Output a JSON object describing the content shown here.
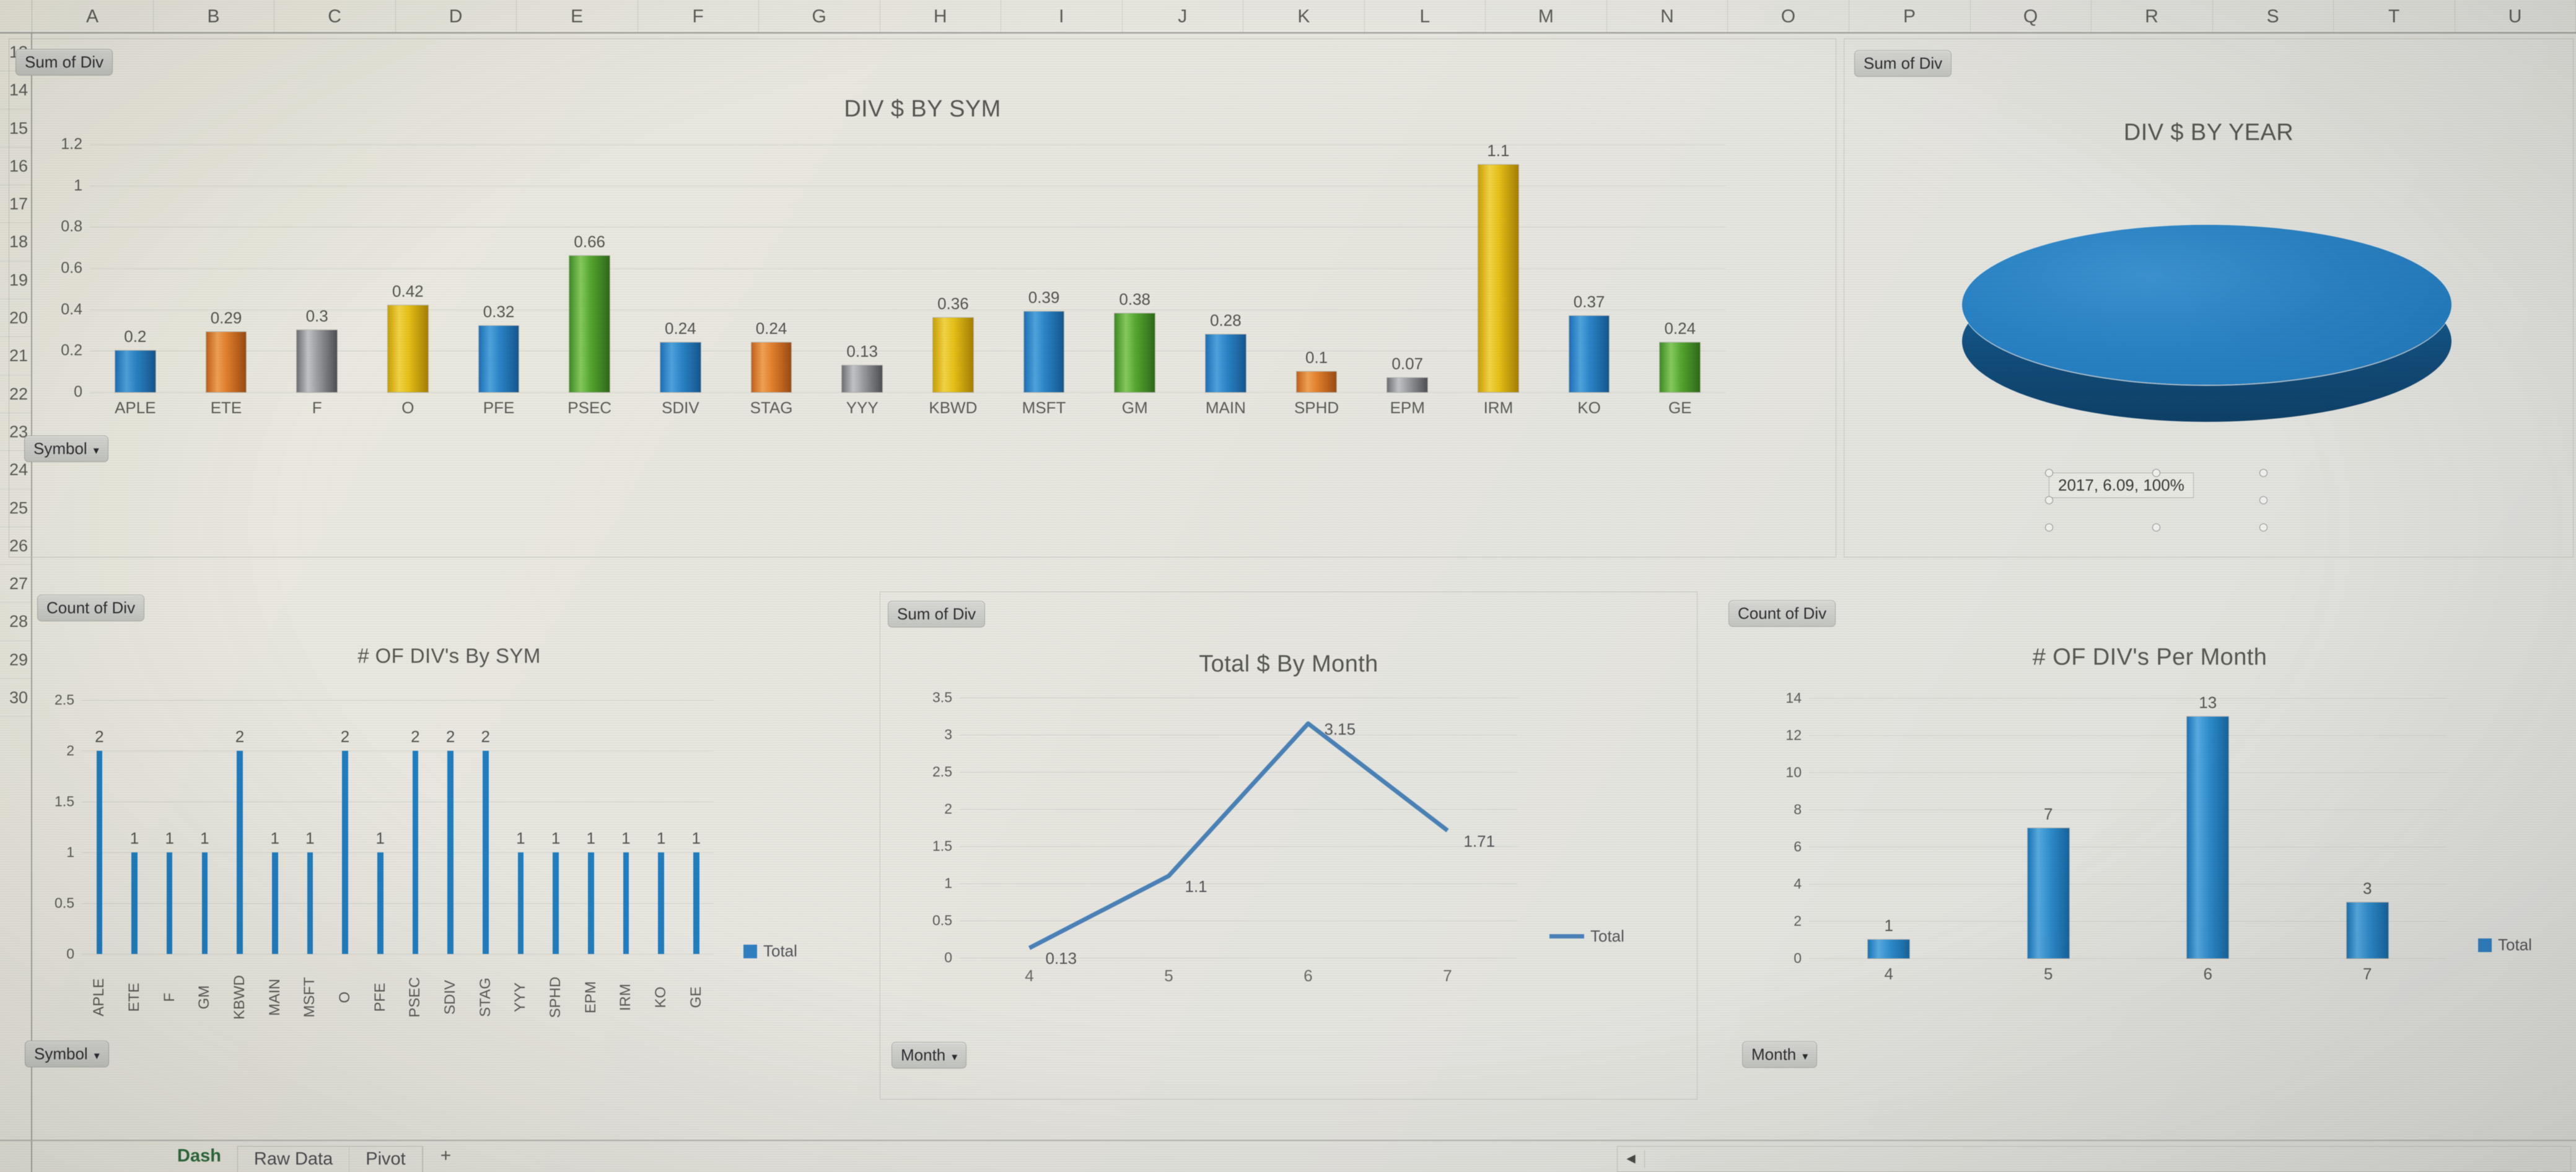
{
  "spreadsheet": {
    "column_headers": [
      "A",
      "B",
      "C",
      "D",
      "E",
      "F",
      "G",
      "H",
      "I",
      "J",
      "K",
      "L",
      "M",
      "N",
      "O",
      "P",
      "Q",
      "R",
      "S",
      "T",
      "U"
    ],
    "row_headers": [
      "13",
      "14",
      "15",
      "16",
      "17",
      "18",
      "19",
      "20",
      "21",
      "22",
      "23",
      "24",
      "25",
      "26",
      "27",
      "28",
      "29",
      "30"
    ],
    "sheet_tabs": [
      {
        "label": "Dash",
        "active": true
      },
      {
        "label": "Raw Data",
        "active": false
      },
      {
        "label": "Pivot",
        "active": false
      }
    ],
    "add_sheet_label": "+",
    "scroll_left_arrow": "◄"
  },
  "charts": {
    "div_by_sym": {
      "field_button": "Sum of Div",
      "slicer_button": "Symbol",
      "slicer_caret": "▾"
    },
    "div_by_year": {
      "field_button": "Sum of Div"
    },
    "div_count_by_sym": {
      "field_button": "Count of Div",
      "slicer_button": "Symbol",
      "slicer_caret": "▾"
    },
    "total_by_month": {
      "field_button": "Sum of Div",
      "slicer_button": "Month",
      "slicer_caret": "▾"
    },
    "count_per_month": {
      "field_button": "Count of Div",
      "slicer_button": "Month",
      "slicer_caret": "▾"
    }
  },
  "chart_data": [
    {
      "id": "div_by_sym",
      "type": "bar",
      "title": "DIV $ BY SYM",
      "xlabel": "",
      "ylabel": "",
      "ylim": [
        0,
        1.2
      ],
      "yticks": [
        "0",
        "0.2",
        "0.4",
        "0.6",
        "0.8",
        "1",
        "1.2"
      ],
      "grid": true,
      "legend": null,
      "categories": [
        "APLE",
        "ETE",
        "F",
        "O",
        "PFE",
        "PSEC",
        "SDIV",
        "STAG",
        "YYY",
        "KBWD",
        "MSFT",
        "GM",
        "MAIN",
        "SPHD",
        "EPM",
        "IRM",
        "KO",
        "GE"
      ],
      "values": [
        0.2,
        0.29,
        0.3,
        0.42,
        0.32,
        0.66,
        0.24,
        0.24,
        0.13,
        0.36,
        0.39,
        0.38,
        0.28,
        0.1,
        0.07,
        1.1,
        0.37,
        0.24
      ],
      "data_labels": [
        "0.2",
        "0.29",
        "0.3",
        "0.42",
        "0.32",
        "0.66",
        "0.24",
        "0.24",
        "0.13",
        "0.36",
        "0.39",
        "0.38",
        "0.28",
        "0.1",
        "0.07",
        "1.1",
        "0.37",
        "0.24"
      ],
      "colors": [
        "#2b85c8",
        "#e2802c",
        "#9a9ca0",
        "#e5c017",
        "#2b85c8",
        "#56a832",
        "#2b85c8",
        "#e2802c",
        "#9a9ca0",
        "#e5c017",
        "#2b85c8",
        "#56a832",
        "#2b85c8",
        "#e2802c",
        "#9a9ca0",
        "#e5c017",
        "#2b85c8",
        "#56a832"
      ],
      "fill_classes": [
        "fill-blue",
        "fill-orange",
        "fill-gray",
        "fill-yellow",
        "fill-blue",
        "fill-green",
        "fill-blue",
        "fill-orange",
        "fill-gray",
        "fill-yellow",
        "fill-blue",
        "fill-green",
        "fill-blue",
        "fill-orange",
        "fill-gray",
        "fill-yellow",
        "fill-blue",
        "fill-green"
      ]
    },
    {
      "id": "div_by_year",
      "type": "pie",
      "title": "DIV $ BY YEAR",
      "labels": [
        "2017"
      ],
      "values": [
        6.09
      ],
      "percentages": [
        "100%"
      ],
      "data_label": "2017, 6.09, 100%",
      "colors": [
        "#2b85c8"
      ],
      "style": "3-D pie",
      "legend": null
    },
    {
      "id": "div_count_by_sym",
      "type": "bar",
      "title": "# OF DIV's By SYM",
      "xlabel": "",
      "ylabel": "",
      "ylim": [
        0,
        2.5
      ],
      "yticks": [
        "0",
        "0.5",
        "1",
        "1.5",
        "2",
        "2.5"
      ],
      "grid": true,
      "legend": "Total",
      "legend_position": "right",
      "categories": [
        "APLE",
        "ETE",
        "F",
        "GM",
        "KBWD",
        "MAIN",
        "MSFT",
        "O",
        "PFE",
        "PSEC",
        "SDIV",
        "STAG",
        "YYY",
        "SPHD",
        "EPM",
        "IRM",
        "KO",
        "GE"
      ],
      "values": [
        2,
        1,
        1,
        1,
        2,
        1,
        1,
        2,
        1,
        2,
        2,
        2,
        1,
        1,
        1,
        1,
        1,
        1
      ],
      "data_labels": [
        "2",
        "1",
        "1",
        "1",
        "2",
        "1",
        "1",
        "2",
        "1",
        "2",
        "2",
        "2",
        "1",
        "1",
        "1",
        "1",
        "1",
        "1"
      ],
      "colors": [
        "#1f7ec0"
      ]
    },
    {
      "id": "total_by_month",
      "type": "line",
      "title": "Total $ By Month",
      "xlabel": "",
      "ylabel": "",
      "ylim": [
        0,
        3.5
      ],
      "yticks": [
        "0",
        "0.5",
        "1",
        "1.5",
        "2",
        "2.5",
        "3",
        "3.5"
      ],
      "grid": true,
      "legend": "Total",
      "legend_position": "right",
      "x": [
        "4",
        "5",
        "6",
        "7"
      ],
      "values": [
        0.13,
        1.1,
        3.15,
        1.71
      ],
      "data_labels": [
        "0.13",
        "1.1",
        "3.15",
        "1.71"
      ],
      "colors": [
        "#4a82b8"
      ]
    },
    {
      "id": "count_per_month",
      "type": "bar",
      "title": "# OF DIV's Per Month",
      "xlabel": "",
      "ylabel": "",
      "ylim": [
        0,
        14
      ],
      "yticks": [
        "0",
        "2",
        "4",
        "6",
        "8",
        "10",
        "12",
        "14"
      ],
      "grid": true,
      "legend": "Total",
      "legend_position": "right",
      "categories": [
        "4",
        "5",
        "6",
        "7"
      ],
      "values": [
        1,
        7,
        13,
        3
      ],
      "data_labels": [
        "1",
        "7",
        "13",
        "3"
      ],
      "colors": [
        "#2d8bcb"
      ]
    }
  ]
}
